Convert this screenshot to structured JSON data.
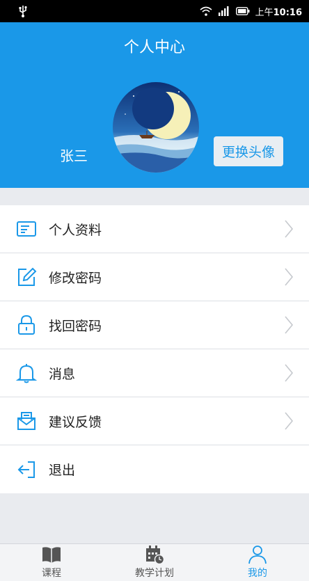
{
  "status": {
    "carrier_time_prefix": "上午",
    "time": "10:16"
  },
  "header": {
    "title": "个人中心",
    "username": "张三",
    "change_avatar_label": "更换头像"
  },
  "menu": [
    {
      "label": "个人资料",
      "icon": "profile-card-icon",
      "chevron": true
    },
    {
      "label": "修改密码",
      "icon": "edit-icon",
      "chevron": true
    },
    {
      "label": "找回密码",
      "icon": "lock-icon",
      "chevron": true
    },
    {
      "label": "消息",
      "icon": "bell-icon",
      "chevron": true
    },
    {
      "label": "建议反馈",
      "icon": "feedback-envelope-icon",
      "chevron": true
    },
    {
      "label": "退出",
      "icon": "logout-icon",
      "chevron": false
    }
  ],
  "tabs": [
    {
      "label": "课程",
      "icon": "book-icon",
      "active": false
    },
    {
      "label": "教学计划",
      "icon": "calendar-clock-icon",
      "active": false
    },
    {
      "label": "我的",
      "icon": "user-icon",
      "active": true
    }
  ],
  "colors": {
    "primary": "#1a98e8",
    "status_bar": "#000000",
    "background": "#e9ebef"
  }
}
